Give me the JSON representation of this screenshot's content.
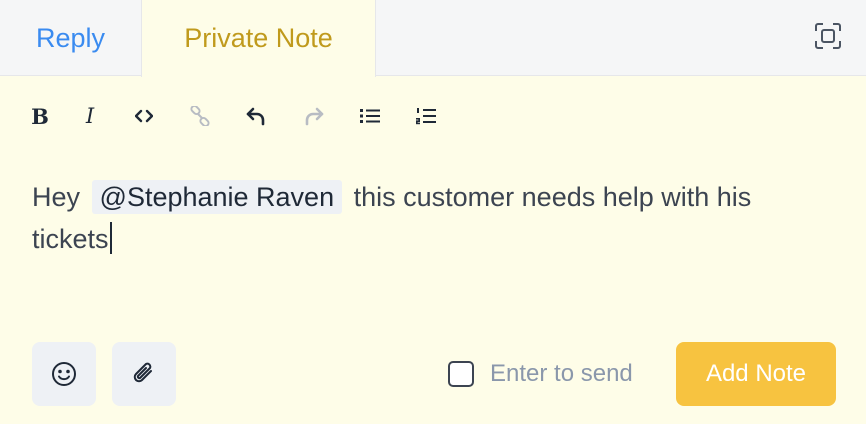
{
  "tabs": [
    {
      "label": "Reply",
      "active": false
    },
    {
      "label": "Private Note",
      "active": true
    }
  ],
  "toolbar": {
    "bold_label": "B",
    "italic_label": "I",
    "code_label": "<>"
  },
  "editor": {
    "text_before": "Hey",
    "mention": "@Stephanie Raven",
    "text_after": "this customer needs help with his tickets"
  },
  "footer": {
    "enter_to_send_label": "Enter to send",
    "enter_to_send_checked": false,
    "add_note_label": "Add Note"
  },
  "colors": {
    "background": "#fefde8",
    "reply_tab": "#3a8bf0",
    "private_note_tab": "#c09a1c",
    "add_note_button": "#f7c340"
  }
}
